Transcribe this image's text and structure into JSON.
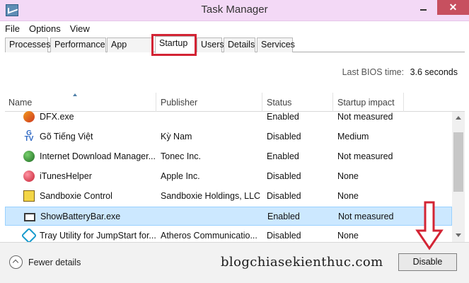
{
  "window": {
    "title": "Task Manager",
    "close_label": "✕"
  },
  "menu": [
    "File",
    "Options",
    "View"
  ],
  "tabs": [
    "Processes",
    "Performance",
    "App history",
    "Startup",
    "Users",
    "Details",
    "Services"
  ],
  "bios": {
    "label": "Last BIOS time:",
    "value": "3.6 seconds"
  },
  "table": {
    "columns": [
      "Name",
      "Publisher",
      "Status",
      "Startup impact"
    ],
    "rows": [
      {
        "name": "DFX.exe",
        "publisher": "",
        "status": "Enabled",
        "impact": "Not measured",
        "icon": "dfx-icon"
      },
      {
        "name": "Gõ Tiếng Việt",
        "publisher": "Kỳ Nam",
        "status": "Disabled",
        "impact": "Medium",
        "icon": "gotiengviet-icon"
      },
      {
        "name": "Internet Download Manager...",
        "publisher": "Tonec Inc.",
        "status": "Enabled",
        "impact": "Not measured",
        "icon": "idm-icon"
      },
      {
        "name": "iTunesHelper",
        "publisher": "Apple Inc.",
        "status": "Disabled",
        "impact": "None",
        "icon": "itunes-icon"
      },
      {
        "name": "Sandboxie Control",
        "publisher": "Sandboxie Holdings, LLC",
        "status": "Disabled",
        "impact": "None",
        "icon": "sandboxie-icon"
      },
      {
        "name": "ShowBatteryBar.exe",
        "publisher": "",
        "status": "Enabled",
        "impact": "Not measured",
        "icon": "battery-icon"
      },
      {
        "name": "Tray Utility for JumpStart for...",
        "publisher": "Atheros Communicatio...",
        "status": "Disabled",
        "impact": "None",
        "icon": "tray-utility-icon"
      }
    ]
  },
  "footer": {
    "fewer_details": "Fewer details",
    "watermark": "blogchiasekienthuc.com",
    "disable_button": "Disable"
  },
  "colors": {
    "title_bar": "#f3d9f6",
    "close_button": "#c7505f",
    "highlight": "#d32434",
    "selected_row": "#cce8ff"
  }
}
